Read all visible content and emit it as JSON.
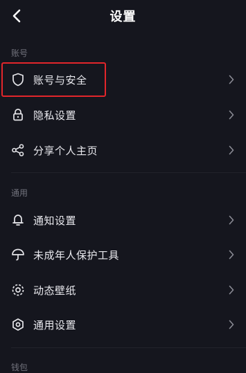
{
  "header": {
    "title": "设置",
    "back_icon": "chevron-left-icon"
  },
  "sections": [
    {
      "label": "账号",
      "items": [
        {
          "label": "账号与安全",
          "icon": "shield-icon"
        },
        {
          "label": "隐私设置",
          "icon": "lock-icon"
        },
        {
          "label": "分享个人主页",
          "icon": "share-icon"
        }
      ]
    },
    {
      "label": "通用",
      "items": [
        {
          "label": "通知设置",
          "icon": "bell-icon"
        },
        {
          "label": "未成年人保护工具",
          "icon": "umbrella-icon"
        },
        {
          "label": "动态壁纸",
          "icon": "wallpaper-icon"
        },
        {
          "label": "通用设置",
          "icon": "hexagon-settings-icon"
        }
      ]
    },
    {
      "label": "钱包",
      "items": []
    }
  ],
  "colors": {
    "background": "#15161e",
    "highlight_border": "#e3262b"
  }
}
